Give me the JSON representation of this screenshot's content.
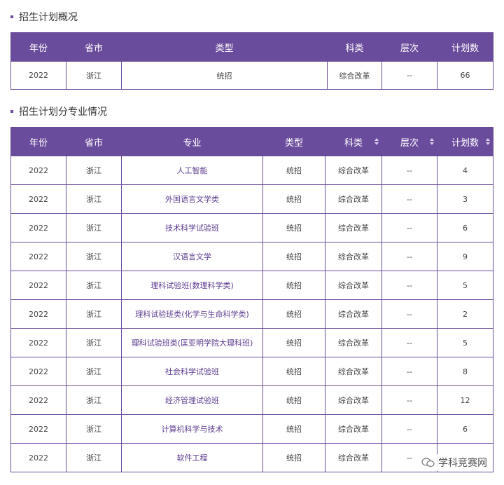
{
  "section1": {
    "title": "招生计划概况"
  },
  "table1": {
    "headers": [
      "年份",
      "省市",
      "类型",
      "科类",
      "层次",
      "计划数"
    ],
    "rows": [
      [
        "2022",
        "浙江",
        "统招",
        "综合改革",
        "--",
        "66"
      ]
    ]
  },
  "section2": {
    "title": "招生计划分专业情况"
  },
  "table2": {
    "headers": [
      "年份",
      "省市",
      "专业",
      "类型",
      "科类",
      "层次",
      "计划数"
    ],
    "rows": [
      [
        "2022",
        "浙江",
        "人工智能",
        "统招",
        "综合改革",
        "--",
        "4"
      ],
      [
        "2022",
        "浙江",
        "外国语言文学类",
        "统招",
        "综合改革",
        "--",
        "3"
      ],
      [
        "2022",
        "浙江",
        "技术科学试验班",
        "统招",
        "综合改革",
        "--",
        "6"
      ],
      [
        "2022",
        "浙江",
        "汉语言文学",
        "统招",
        "综合改革",
        "--",
        "9"
      ],
      [
        "2022",
        "浙江",
        "理科试验班(数理科学类)",
        "统招",
        "综合改革",
        "--",
        "5"
      ],
      [
        "2022",
        "浙江",
        "理科试验班类(化学与生命科学类)",
        "统招",
        "综合改革",
        "--",
        "2"
      ],
      [
        "2022",
        "浙江",
        "理科试验班类(匡亚明学院大理科班)",
        "统招",
        "综合改革",
        "--",
        "5"
      ],
      [
        "2022",
        "浙江",
        "社会科学试验班",
        "统招",
        "综合改革",
        "--",
        "8"
      ],
      [
        "2022",
        "浙江",
        "经济管理试验班",
        "统招",
        "综合改革",
        "--",
        "12"
      ],
      [
        "2022",
        "浙江",
        "计算机科学与技术",
        "统招",
        "综合改革",
        "--",
        "6"
      ],
      [
        "2022",
        "浙江",
        "软件工程",
        "统招",
        "综合改革",
        "--",
        ""
      ]
    ]
  },
  "watermark": {
    "text": "学科竞赛网",
    "icon": "wechat-icon"
  },
  "colors": {
    "header_bg": "#6a4c9c",
    "major_text": "#5b3a8e"
  }
}
